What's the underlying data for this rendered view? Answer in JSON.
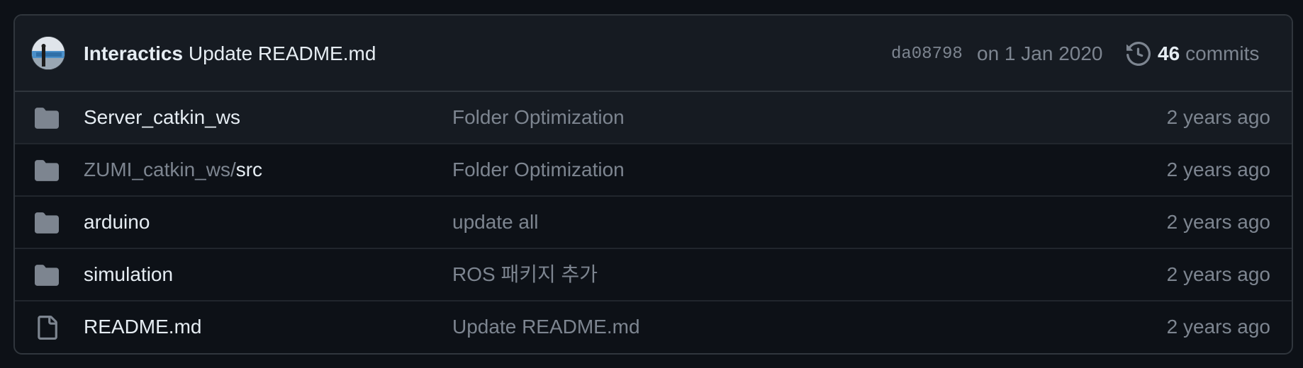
{
  "last_commit": {
    "author": "Interactics",
    "message": "Update README.md",
    "sha": "da08798",
    "date": "on 1 Jan 2020",
    "commits_count": "46",
    "commits_label": "commits",
    "avatar_icon": "user-avatar"
  },
  "files": [
    {
      "type": "folder",
      "icon": "folder-icon",
      "prefix": "",
      "name": "Server_catkin_ws",
      "message": "Folder Optimization",
      "age": "2 years ago"
    },
    {
      "type": "folder",
      "icon": "folder-icon",
      "prefix": "ZUMI_catkin_ws/",
      "name": "src",
      "message": "Folder Optimization",
      "age": "2 years ago"
    },
    {
      "type": "folder",
      "icon": "folder-icon",
      "prefix": "",
      "name": "arduino",
      "message": "update all",
      "age": "2 years ago"
    },
    {
      "type": "folder",
      "icon": "folder-icon",
      "prefix": "",
      "name": "simulation",
      "message": "ROS 패키지 추가",
      "age": "2 years ago"
    },
    {
      "type": "file",
      "icon": "file-icon",
      "prefix": "",
      "name": "README.md",
      "message": "Update README.md",
      "age": "2 years ago"
    }
  ],
  "colors": {
    "background": "#0d1117",
    "header_bg": "#161b22",
    "border": "#30363d",
    "text_primary": "#e6edf3",
    "text_muted": "#7d8590",
    "folder_icon": "#7d8590"
  }
}
